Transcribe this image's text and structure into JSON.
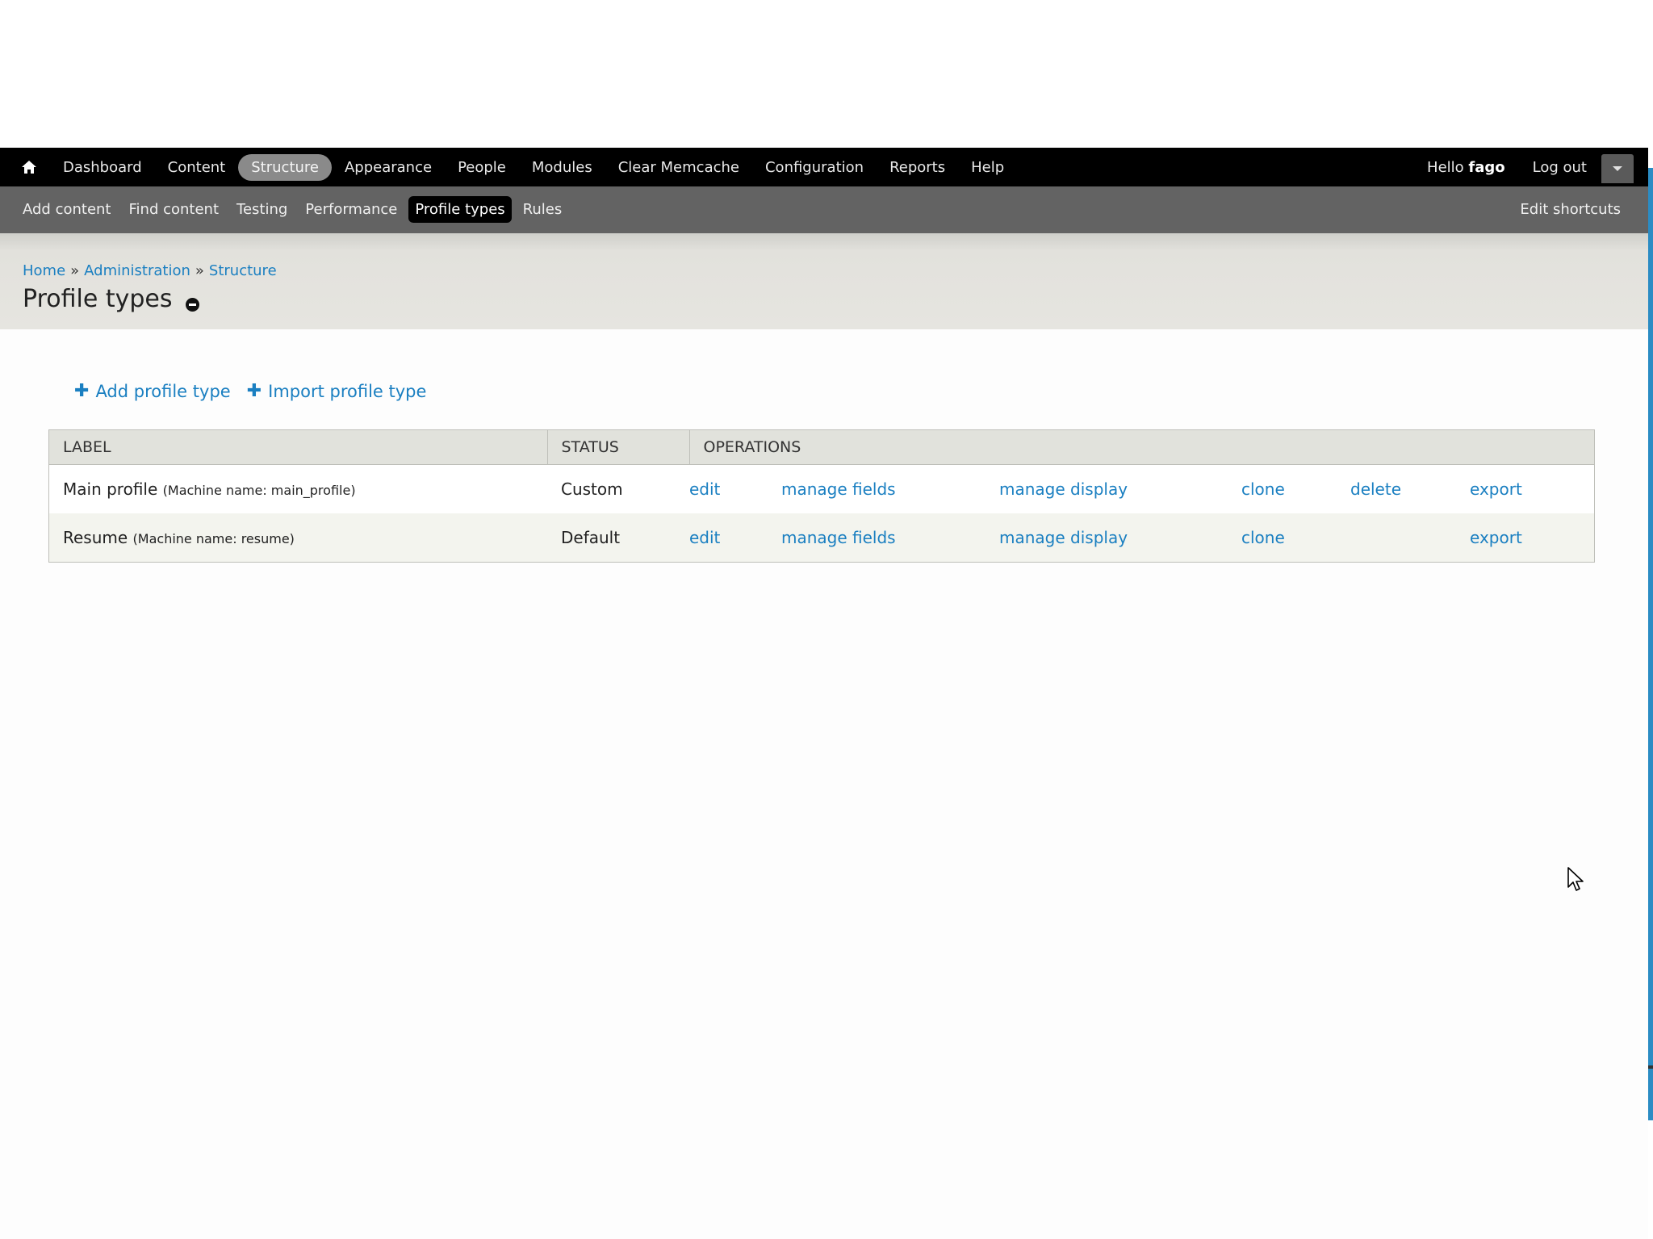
{
  "toolbar": {
    "home_icon": "home-icon",
    "menu": [
      {
        "label": "Dashboard",
        "active": false
      },
      {
        "label": "Content",
        "active": false
      },
      {
        "label": "Structure",
        "active": true
      },
      {
        "label": "Appearance",
        "active": false
      },
      {
        "label": "People",
        "active": false
      },
      {
        "label": "Modules",
        "active": false
      },
      {
        "label": "Clear Memcache",
        "active": false
      },
      {
        "label": "Configuration",
        "active": false
      },
      {
        "label": "Reports",
        "active": false
      },
      {
        "label": "Help",
        "active": false
      }
    ],
    "greeting_prefix": "Hello",
    "username": "fago",
    "logout_label": "Log out",
    "drawer_icon": "chevron-down-icon"
  },
  "shortcuts": {
    "items": [
      {
        "label": "Add content",
        "active": false
      },
      {
        "label": "Find content",
        "active": false
      },
      {
        "label": "Testing",
        "active": false
      },
      {
        "label": "Performance",
        "active": false
      },
      {
        "label": "Profile types",
        "active": true
      },
      {
        "label": "Rules",
        "active": false
      }
    ],
    "edit_label": "Edit shortcuts"
  },
  "breadcrumb": {
    "items": [
      "Home",
      "Administration",
      "Structure"
    ],
    "separator": "»"
  },
  "page": {
    "title": "Profile types"
  },
  "actions": {
    "add_label": "Add profile type",
    "import_label": "Import profile type"
  },
  "table": {
    "headers": [
      "LABEL",
      "STATUS",
      "OPERATIONS"
    ],
    "rows": [
      {
        "label": "Main profile",
        "machine": "(Machine name: main_profile)",
        "status": "Custom",
        "ops": [
          "edit",
          "manage fields",
          "manage display",
          "clone",
          "delete",
          "export"
        ]
      },
      {
        "label": "Resume",
        "machine": "(Machine name: resume)",
        "status": "Default",
        "ops": [
          "edit",
          "manage fields",
          "manage display",
          "clone",
          "",
          "export"
        ]
      }
    ]
  },
  "colors": {
    "link": "#1a7fc1",
    "toolbar_bg": "#000000",
    "shortcuts_bg": "#636363",
    "header_bg": "#e6e5e0",
    "active_menu_bg": "#8a8a8a"
  }
}
